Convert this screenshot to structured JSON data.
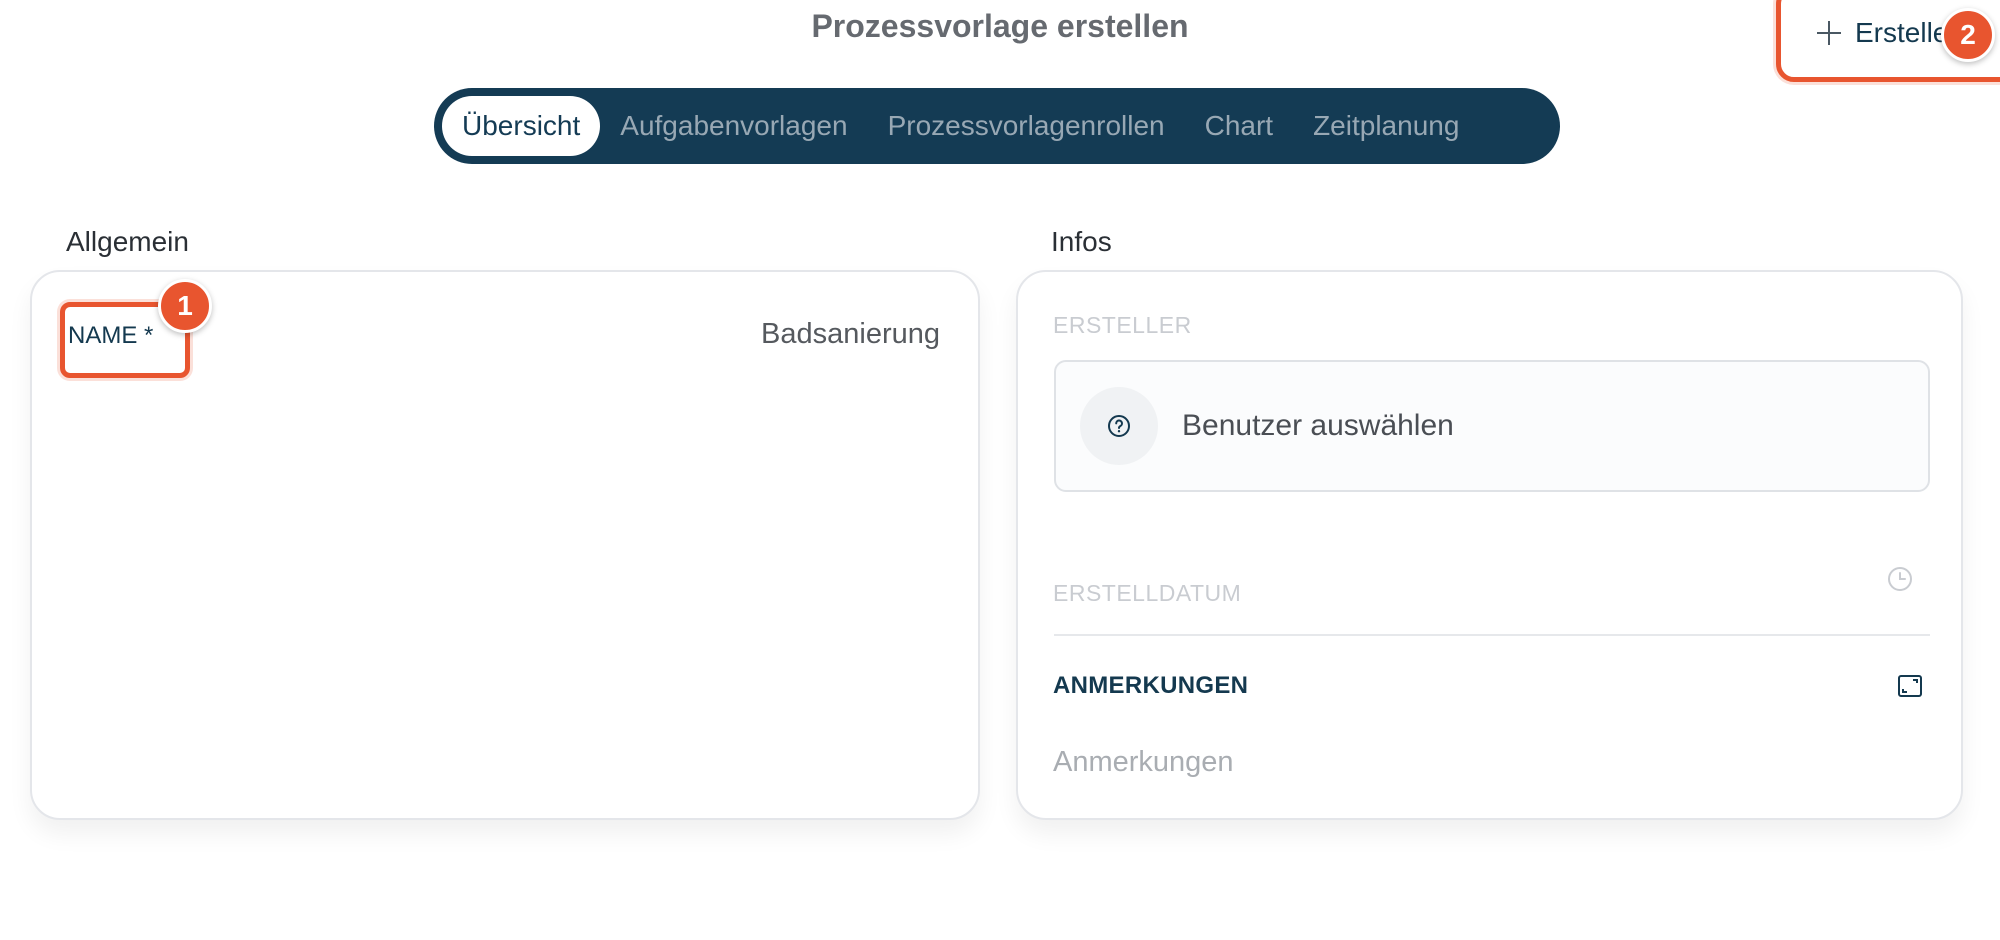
{
  "page": {
    "title": "Prozessvorlage erstellen"
  },
  "header": {
    "create_button_label": "Erstellen",
    "icon": "plus-icon"
  },
  "annotations": {
    "badge_1": "1",
    "badge_2": "2",
    "accent_color": "#e8552f"
  },
  "tabs": [
    {
      "label": "Übersicht",
      "active": true
    },
    {
      "label": "Aufgabenvorlagen",
      "active": false
    },
    {
      "label": "Prozessvorlagenrollen",
      "active": false
    },
    {
      "label": "Chart",
      "active": false
    },
    {
      "label": "Zeitplanung",
      "active": false
    }
  ],
  "general": {
    "section_title": "Allgemein",
    "name_label": "NAME *",
    "name_value": "Badsanierung"
  },
  "info": {
    "section_title": "Infos",
    "creator_label": "ERSTELLER",
    "creator_placeholder": "Benutzer auswählen",
    "created_date_label": "ERSTELLDATUM",
    "notes_label": "ANMERKUNGEN",
    "notes_placeholder": "Anmerkungen",
    "icons": [
      "help-circle-icon",
      "clock-icon",
      "expand-icon"
    ]
  },
  "colors": {
    "tab_bar": "#143b54",
    "text_dark": "#14394f"
  }
}
